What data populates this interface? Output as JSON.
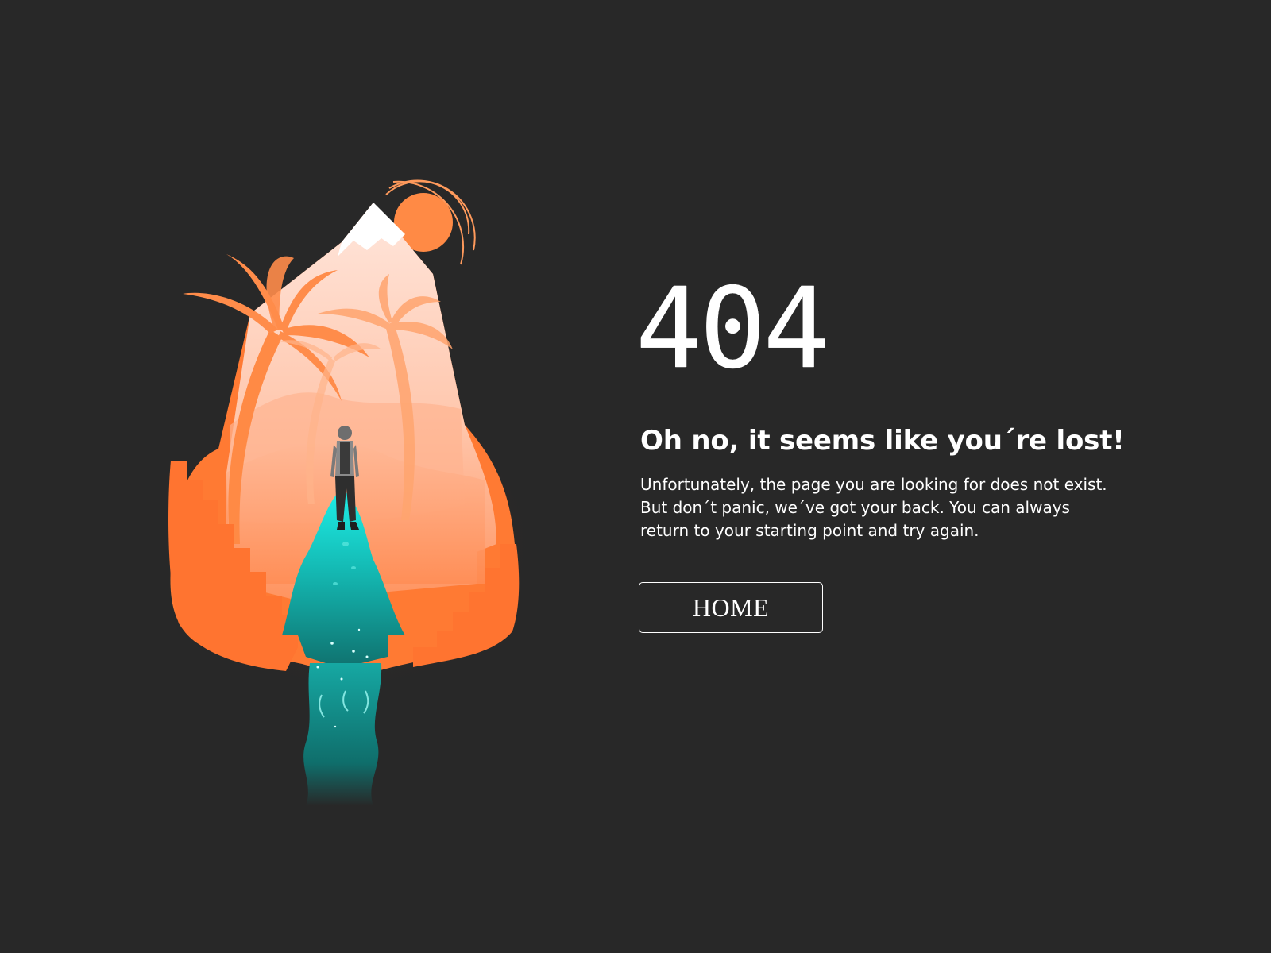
{
  "error": {
    "code": "404",
    "headline": "Oh no, it seems like you´re lost!",
    "body": "Unfortunately, the page you are looking for does not exist. But don´t panic, we´ve got your back. You can always return to your starting point and try again.",
    "home_button_label": "HOME"
  },
  "illustration": {
    "icons": [
      "sun-icon",
      "mountain-icon",
      "palm-tree-icon",
      "person-icon",
      "waterfall-icon"
    ],
    "colors": {
      "background": "#282828",
      "orange": "#ff7a33",
      "peach": "#ffb08a",
      "light_peach": "#ffe2d6",
      "teal": "#17c4c0",
      "white": "#ffffff"
    }
  }
}
